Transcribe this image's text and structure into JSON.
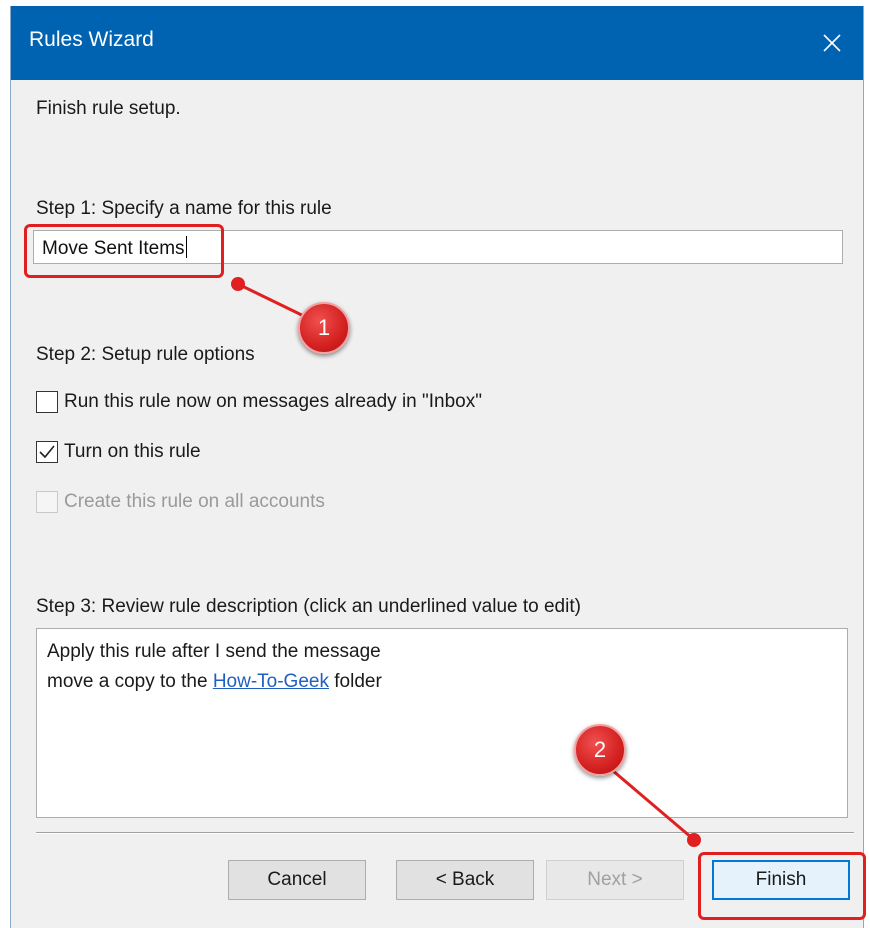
{
  "window": {
    "title": "Rules Wizard",
    "close_icon": "close-icon"
  },
  "header": {
    "instruction": "Finish rule setup."
  },
  "step1": {
    "label": "Step 1: Specify a name for this rule",
    "name_value": "Move Sent Items"
  },
  "step2": {
    "label": "Step 2: Setup rule options",
    "options": [
      {
        "label": "Run this rule now on messages already in \"Inbox\"",
        "checked": false,
        "enabled": true
      },
      {
        "label": "Turn on this rule",
        "checked": true,
        "enabled": true
      },
      {
        "label": "Create this rule on all accounts",
        "checked": false,
        "enabled": false
      }
    ]
  },
  "step3": {
    "label": "Step 3: Review rule description (click an underlined value to edit)",
    "line1": "Apply this rule after I send the message",
    "line2_prefix": "move a copy to the ",
    "line2_link": "How-To-Geek",
    "line2_suffix": " folder"
  },
  "buttons": {
    "cancel": "Cancel",
    "back": "< Back",
    "next": "Next >",
    "finish": "Finish"
  },
  "annotations": {
    "badge1": "1",
    "badge2": "2",
    "color": "#e02020"
  }
}
